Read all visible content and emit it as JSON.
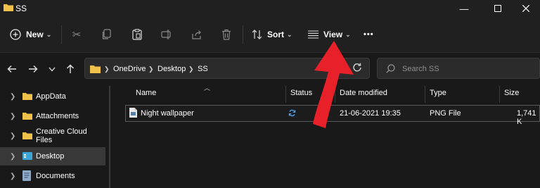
{
  "window": {
    "title": "SS"
  },
  "toolbar": {
    "new_label": "New",
    "sort_label": "Sort",
    "view_label": "View",
    "more_label": "•••"
  },
  "address": {
    "crumbs": [
      "OneDrive",
      "Desktop",
      "SS"
    ]
  },
  "search": {
    "placeholder": "Search SS"
  },
  "nav_pane": {
    "items": [
      {
        "label": "AppData",
        "icon": "folder-icon",
        "selected": false
      },
      {
        "label": "Attachments",
        "icon": "folder-icon",
        "selected": false
      },
      {
        "label": "Creative Cloud Files",
        "icon": "folder-icon",
        "selected": false
      },
      {
        "label": "Desktop",
        "icon": "desktop-icon",
        "selected": true
      },
      {
        "label": "Documents",
        "icon": "documents-icon",
        "selected": false
      }
    ]
  },
  "file_list": {
    "columns": [
      "Name",
      "Status",
      "Date modified",
      "Type",
      "Size"
    ],
    "rows": [
      {
        "name": "Night wallpaper",
        "status_icon": "sync-icon",
        "date": "21-06-2021 19:35",
        "type": "PNG File",
        "size": "1,741 K"
      }
    ]
  },
  "colors": {
    "background": "#191919",
    "chrome": "#202020",
    "folder": "#f0c14b",
    "annotation_arrow": "#e8202a",
    "sync": "#4aa3f0"
  }
}
